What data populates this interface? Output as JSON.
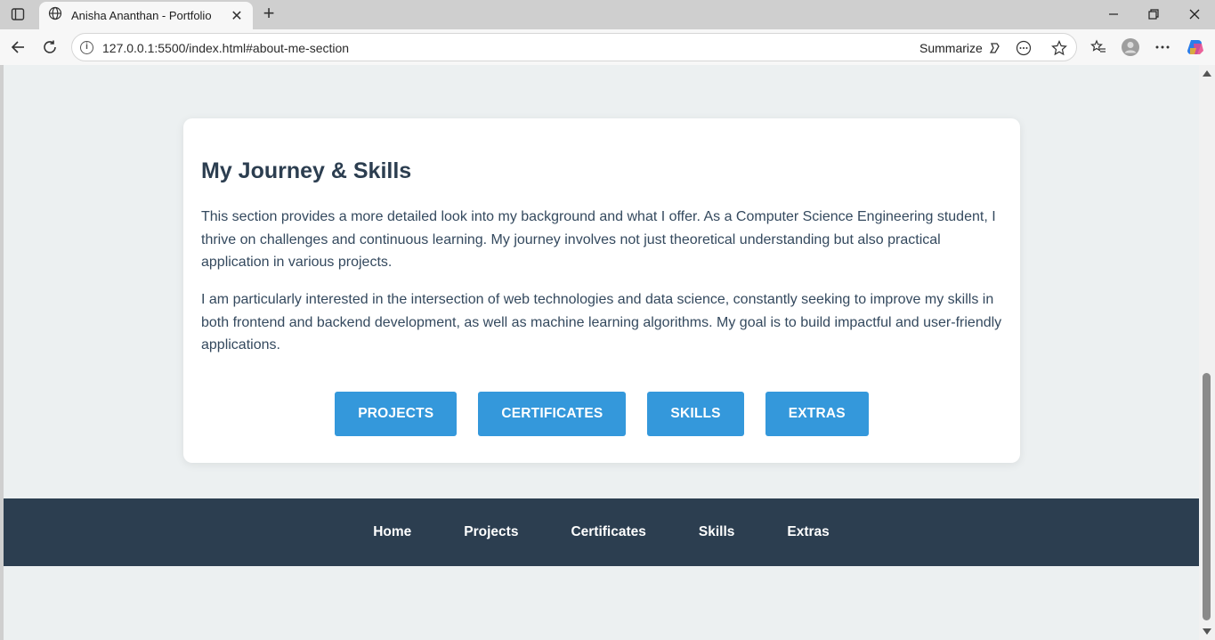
{
  "browser": {
    "tab_title": "Anisha Ananthan - Portfolio",
    "tab_close": "✕",
    "new_tab": "+",
    "url": "127.0.0.1:5500/index.html#about-me-section",
    "summarize_label": "Summarize"
  },
  "section": {
    "heading": "My Journey & Skills",
    "paragraph1": "This section provides a more detailed look into my background and what I offer. As a Computer Science Engineering student, I thrive on challenges and continuous learning. My journey involves not just theoretical understanding but also practical application in various projects.",
    "paragraph2": "I am particularly interested in the intersection of web technologies and data science, constantly seeking to improve my skills in both frontend and backend development, as well as machine learning algorithms. My goal is to build impactful and user-friendly applications.",
    "buttons": [
      "PROJECTS",
      "CERTIFICATES",
      "SKILLS",
      "EXTRAS"
    ]
  },
  "footer": {
    "links": [
      "Home",
      "Projects",
      "Certificates",
      "Skills",
      "Extras"
    ]
  },
  "colors": {
    "accent": "#3498db",
    "footer_bg": "#2c3e50",
    "page_bg": "#ecf0f1",
    "heading": "#2c3e50"
  }
}
